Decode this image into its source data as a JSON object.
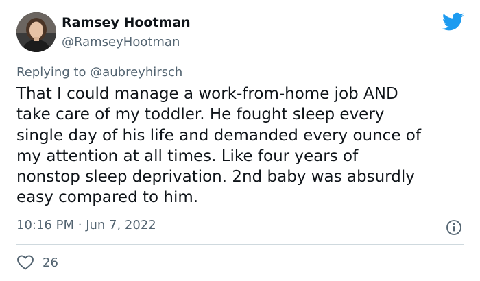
{
  "author": {
    "name": "Ramsey Hootman",
    "handle": "@RamseyHootman",
    "avatar_icon": "profile-photo"
  },
  "brand": {
    "icon": "twitter-bird-icon",
    "color": "#1d9bf0"
  },
  "reply": {
    "prefix": "Replying to",
    "to": "@aubreyhirsch"
  },
  "tweet": {
    "lines": [
      "That I could manage a work-from-home job AND",
      "take care of my toddler. He fought sleep every",
      "single day of his life and demanded every ounce of",
      "my attention at all times. Like four years of",
      "nonstop sleep deprivation. 2nd baby was absurdly",
      "easy compared to him."
    ]
  },
  "meta": {
    "time": "10:16 PM",
    "separator": "·",
    "date": "Jun 7, 2022",
    "info_icon": "info-icon"
  },
  "engagement": {
    "like_icon": "heart-icon",
    "likes": "26"
  }
}
